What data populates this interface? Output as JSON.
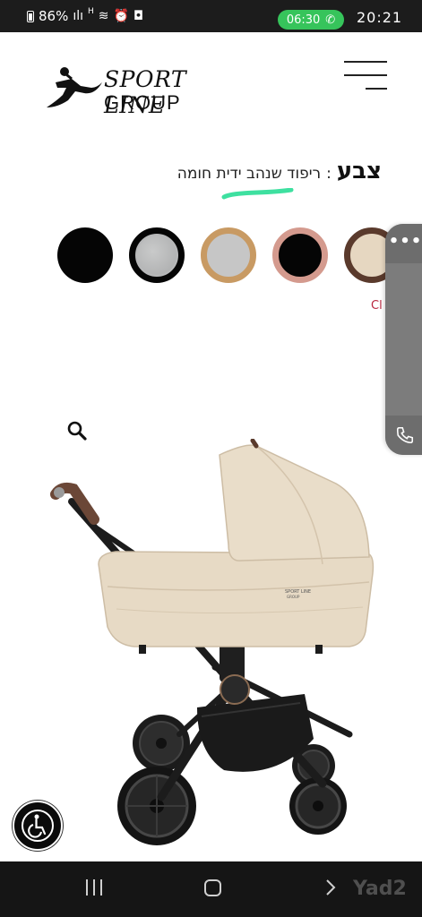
{
  "status_bar": {
    "battery": "86%",
    "network_label": "H",
    "call_time": "06:30",
    "clock": "20:21"
  },
  "header": {
    "logo_line1": "SPORT LINE",
    "logo_line2": "GROUP",
    "menu_icon": "hamburger-menu-icon"
  },
  "product_options": {
    "color_label": "צבע",
    "separator": ":",
    "selected_color": "ריפוד שנהב ידית חומה",
    "swatches": [
      {
        "name": "black",
        "fill": "#050505",
        "ring": "#050505"
      },
      {
        "name": "grey",
        "fill": "#b7b8b9",
        "ring": "#050505"
      },
      {
        "name": "cognac",
        "fill": "#c6c6c6",
        "ring": "#c89a63"
      },
      {
        "name": "rose",
        "fill": "#050505",
        "ring": "#d49a8e"
      },
      {
        "name": "ivory-brown",
        "fill": "#e6d7c1",
        "ring": "#5a3a2c"
      }
    ],
    "clear_link": "Cl"
  },
  "side_panel": {
    "more_icon": "more-dots-icon",
    "more_label": "•••",
    "phone_icon": "phone-icon"
  },
  "product_image": {
    "zoom_icon": "zoom-magnifier-icon",
    "brand_print_line1": "SPORT LINE",
    "brand_print_line2": "GROUP"
  },
  "accessibility": {
    "icon": "wheelchair-accessibility-icon"
  },
  "nav_bar": {
    "recents_icon": "recents-icon",
    "home_icon": "home-icon",
    "back_icon": "back-chevron-icon",
    "watermark": "Yad2"
  },
  "colors": {
    "accent_underline": "#3ee0a0",
    "call_pill": "#36c45b",
    "clear_link": "#b9263f",
    "side_panel": "#7c7c7c"
  }
}
